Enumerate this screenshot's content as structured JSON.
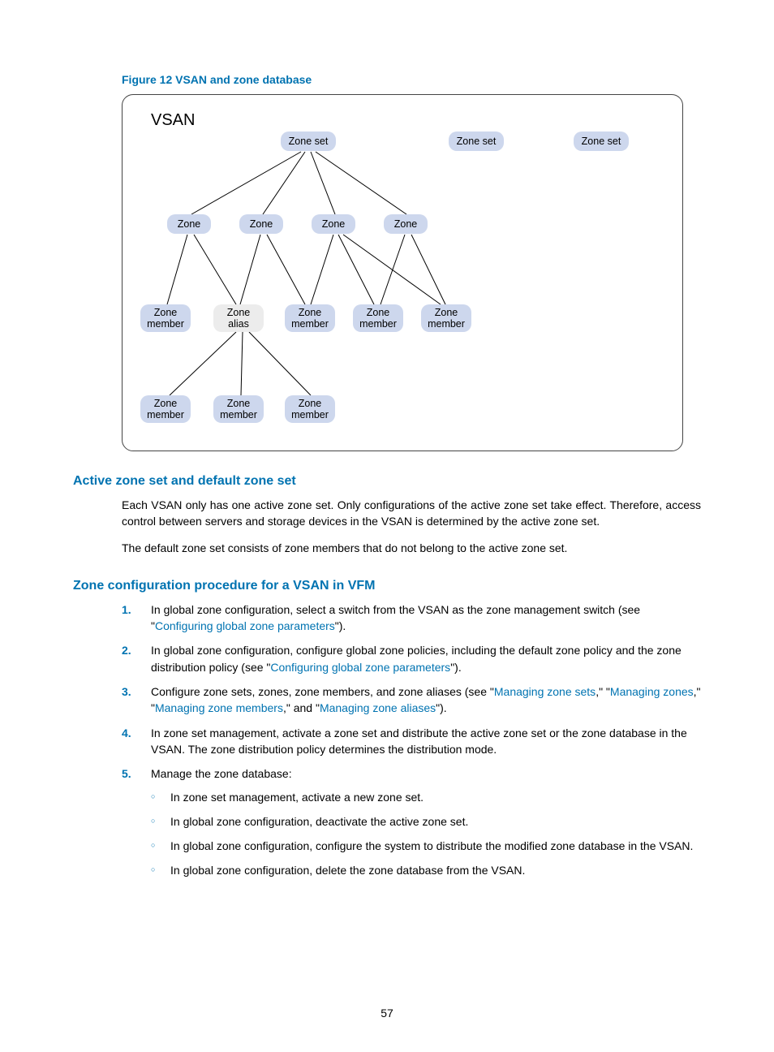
{
  "figure": {
    "caption": "Figure 12 VSAN and zone database",
    "title": "VSAN",
    "nodes": {
      "zs1": "Zone set",
      "zs2": "Zone set",
      "zs3": "Zone set",
      "z1": "Zone",
      "z2": "Zone",
      "z3": "Zone",
      "z4": "Zone",
      "m1": "Zone\nmember",
      "alias": "Zone\nalias",
      "m3": "Zone\nmember",
      "m4": "Zone\nmember",
      "m5": "Zone\nmember",
      "am1": "Zone\nmember",
      "am2": "Zone\nmember",
      "am3": "Zone\nmember"
    }
  },
  "section1": {
    "heading": "Active zone set and default zone set",
    "p1": "Each VSAN only has one active zone set. Only configurations of the active zone set take effect. Therefore, access control between servers and storage devices in the VSAN is determined by the active zone set.",
    "p2": "The default zone set consists of zone members that do not belong to the active zone set."
  },
  "section2": {
    "heading": "Zone configuration procedure for a VSAN in VFM",
    "steps": [
      {
        "pre": "In global zone configuration, select a switch from the VSAN as the zone management switch (see \"",
        "link1": "Configuring global zone parameters",
        "post": "\")."
      },
      {
        "pre": "In global zone configuration, configure global zone policies, including the default zone policy and the zone distribution policy (see \"",
        "link1": "Configuring global zone parameters",
        "post": "\")."
      },
      {
        "pre": "Configure zone sets, zones, zone members, and zone aliases (see \"",
        "link1": "Managing zone sets",
        "mid1": ",\" \"",
        "link2": "Managing zones",
        "mid2": ",\" \"",
        "link3": "Managing zone members",
        "mid3": ",\" and \"",
        "link4": "Managing zone aliases",
        "post": "\")."
      },
      {
        "pre": "In zone set management, activate a zone set and distribute the active zone set or the zone database in the VSAN. The zone distribution policy determines the distribution mode."
      },
      {
        "pre": "Manage the zone database:",
        "subs": [
          "In zone set management, activate a new zone set.",
          "In global zone configuration, deactivate the active zone set.",
          "In global zone configuration, configure the system to distribute the modified zone database in the VSAN.",
          "In global zone configuration, delete the zone database from the VSAN."
        ]
      }
    ]
  },
  "pageNumber": "57"
}
